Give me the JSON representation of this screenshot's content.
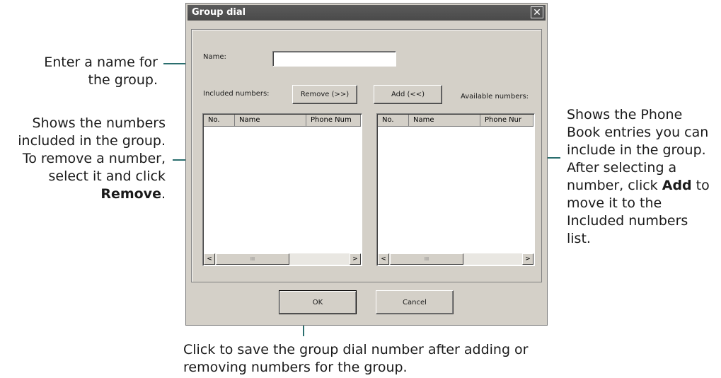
{
  "dialog": {
    "title": "Group dial",
    "close_glyph": "✕",
    "name_label": "Name:",
    "name_value": "",
    "included_label": "Included numbers:",
    "available_label": "Available numbers:",
    "remove_button": "Remove (>>)",
    "add_button": "Add (<<)",
    "included_columns": [
      "No.",
      "Name",
      "Phone Num"
    ],
    "available_columns": [
      "No.",
      "Name",
      "Phone Nur"
    ],
    "scroll_left": "<",
    "scroll_right": ">",
    "thumb_grip": "III",
    "ok_button": "OK",
    "cancel_button": "Cancel"
  },
  "callouts": {
    "name": {
      "line1": "Enter a name for",
      "line2": "the group."
    },
    "included": {
      "line1": "Shows the numbers",
      "line2": "included in the group.",
      "line3": "To remove a number,",
      "line4": "select it and click",
      "line5": "Remove",
      "line5_suffix": "."
    },
    "available": {
      "line1": "Shows the Phone",
      "line2": "Book entries you can",
      "line3": "include in the group.",
      "line4": "After selecting a",
      "line5_prefix": "number, click ",
      "line5_bold": "Add",
      "line5_suffix": " to",
      "line6": "move it to the",
      "line7": "Included numbers",
      "line8": "list."
    },
    "ok": {
      "line1": "Click to save the group dial number after adding or",
      "line2": "removing numbers for the group."
    }
  },
  "colors": {
    "leader": "#2a6e6e",
    "dialog_bg": "#d4d0c8",
    "titlebar": "#4f4f4f"
  }
}
